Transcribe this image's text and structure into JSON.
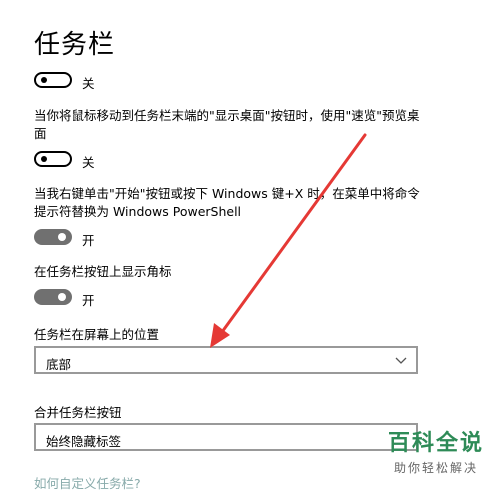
{
  "page": {
    "title": "任务栏"
  },
  "settings": {
    "lock_taskbar": {
      "state_label": "关",
      "on": false
    },
    "peek": {
      "description": "当你将鼠标移动到任务栏末端的\"显示桌面\"按钮时，使用\"速览\"预览桌面",
      "state_label": "关",
      "on": false
    },
    "powershell": {
      "description": "当我右键单击\"开始\"按钮或按下 Windows 键+X 时，在菜单中将命令提示符替换为 Windows PowerShell",
      "state_label": "开",
      "on": true
    },
    "badges": {
      "description": "在任务栏按钮上显示角标",
      "state_label": "开",
      "on": true
    },
    "location": {
      "label": "任务栏在屏幕上的位置",
      "value": "底部"
    },
    "combine": {
      "label": "合并任务栏按钮",
      "value": "始终隐藏标签"
    },
    "customize_link": "如何自定义任务栏?"
  },
  "watermark": {
    "title": "百科全说",
    "subtitle": "助你轻松解决"
  },
  "colors": {
    "arrow": "#e53935",
    "watermark_green": "#2e8b57",
    "toggle_on": "#707070"
  }
}
